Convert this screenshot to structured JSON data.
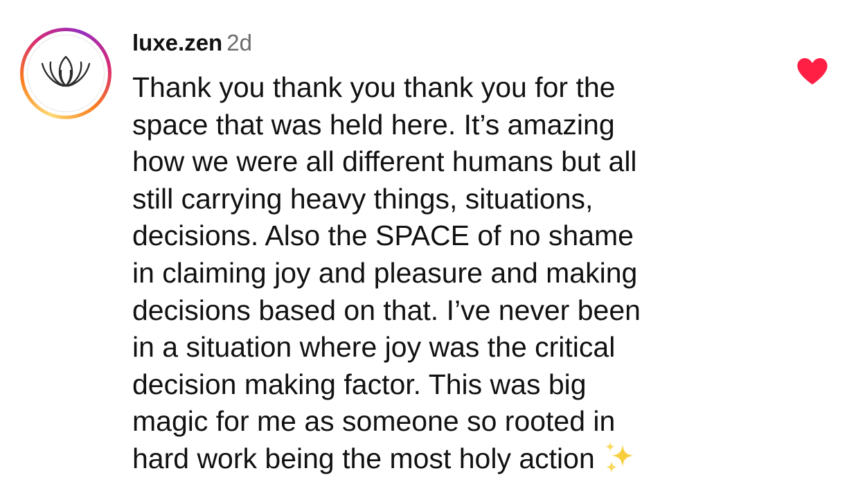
{
  "comment": {
    "username": "luxe.zen",
    "timestamp": "2d",
    "avatar_icon": "lotus-logo-icon",
    "liked": true,
    "like_color": "#ff1f45",
    "text_lines": [
      "Thank you thank you thank you for the",
      "space that was held here. It’s amazing",
      "how we were all different humans but all",
      "still carrying heavy things, situations,",
      "decisions. Also the SPACE of no shame",
      "in claiming joy and pleasure and making",
      "decisions based on that. I’ve never been",
      "in a situation where joy was the critical",
      "decision making factor. This was big",
      "magic for me as someone so rooted in",
      "hard work being the most holy action"
    ],
    "trailing_emoji": "sparkles-icon"
  }
}
